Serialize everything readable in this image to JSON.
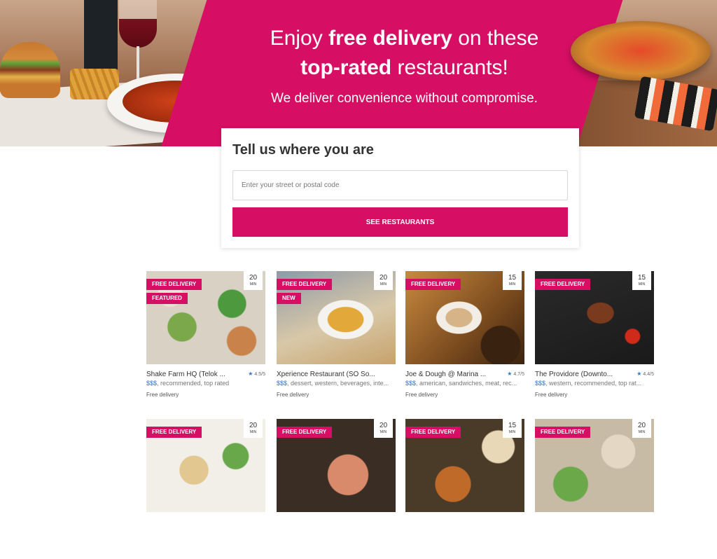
{
  "hero": {
    "line1_pre": "Enjoy ",
    "line1_bold": "free delivery",
    "line1_post": " on these",
    "line2_bold": "top-rated",
    "line2_post": " restaurants!",
    "subtitle": "We deliver convenience without compromise."
  },
  "search": {
    "title": "Tell us where you are",
    "placeholder": "Enter your street or postal code",
    "button_label": "SEE RESTAURANTS"
  },
  "colors": {
    "brand_pink": "#d70f64",
    "rating_star": "#3575c7"
  },
  "restaurants": [
    {
      "tag1": "FREE DELIVERY",
      "tag2": "FEATURED",
      "time": "20",
      "time_unit": "MIN",
      "name": "Shake Farm HQ (Telok ...",
      "rating": "4.5/5",
      "price": "$$$",
      "cuisines": ", recommended, top rated",
      "fee": "Free delivery"
    },
    {
      "tag1": "FREE DELIVERY",
      "tag2": "NEW",
      "time": "20",
      "time_unit": "MIN",
      "name": "Xperience Restaurant (SO So...",
      "rating": "",
      "price": "$$$",
      "cuisines": ", dessert, western, beverages, inte...",
      "fee": "Free delivery"
    },
    {
      "tag1": "FREE DELIVERY",
      "tag2": "",
      "time": "15",
      "time_unit": "MIN",
      "name": "Joe & Dough @ Marina ...",
      "rating": "4.7/5",
      "price": "$$$",
      "cuisines": ", american, sandwiches, meat, rec...",
      "fee": "Free delivery"
    },
    {
      "tag1": "FREE DELIVERY",
      "tag2": "",
      "time": "15",
      "time_unit": "MIN",
      "name": "The Providore (Downto...",
      "rating": "4.4/5",
      "price": "$$$",
      "cuisines": ", western, recommended, top rat...",
      "fee": "Free delivery"
    },
    {
      "tag1": "FREE DELIVERY",
      "time": "20",
      "time_unit": "MIN"
    },
    {
      "tag1": "FREE DELIVERY",
      "time": "20",
      "time_unit": "MIN"
    },
    {
      "tag1": "FREE DELIVERY",
      "time": "15",
      "time_unit": "MIN"
    },
    {
      "tag1": "FREE DELIVERY",
      "time": "20",
      "time_unit": "MIN"
    }
  ]
}
